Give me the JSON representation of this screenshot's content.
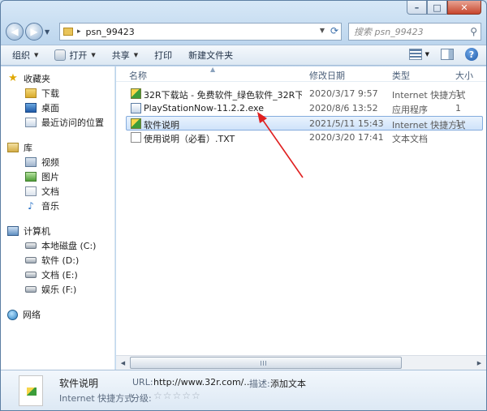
{
  "window": {
    "minimize_glyph": "–",
    "maximize_glyph": "□",
    "close_glyph": "✕"
  },
  "address": {
    "path": "psn_99423",
    "search_placeholder": "搜索 psn_99423"
  },
  "toolbar": {
    "organize": "组织",
    "open": "打开",
    "share": "共享",
    "print": "打印",
    "new_folder": "新建文件夹",
    "help": "?"
  },
  "nav": {
    "favorites": {
      "label": "收藏夹",
      "items": [
        {
          "label": "下载"
        },
        {
          "label": "桌面"
        },
        {
          "label": "最近访问的位置"
        }
      ]
    },
    "libraries": {
      "label": "库",
      "items": [
        {
          "label": "视频"
        },
        {
          "label": "图片"
        },
        {
          "label": "文档"
        },
        {
          "label": "音乐"
        }
      ]
    },
    "computer": {
      "label": "计算机",
      "items": [
        {
          "label": "本地磁盘 (C:)"
        },
        {
          "label": "软件 (D:)"
        },
        {
          "label": "文档 (E:)"
        },
        {
          "label": "娱乐 (F:)"
        }
      ]
    },
    "network": {
      "label": "网络"
    }
  },
  "columns": {
    "name": "名称",
    "date": "修改日期",
    "type": "类型",
    "size": "大小"
  },
  "files": [
    {
      "name": "32R下载站 - 免费软件_绿色软件_32R下...",
      "date": "2020/3/17 9:57",
      "type": "Internet 快捷方式",
      "size": "1"
    },
    {
      "name": "PlayStationNow-11.2.2.exe",
      "date": "2020/8/6 13:52",
      "type": "应用程序",
      "size": "1"
    },
    {
      "name": "软件说明",
      "date": "2021/5/11 15:43",
      "type": "Internet 快捷方式",
      "size": "1"
    },
    {
      "name": "使用说明（必看）.TXT",
      "date": "2020/3/20 17:41",
      "type": "文本文档",
      "size": ""
    }
  ],
  "details": {
    "title": "软件说明",
    "url_label": "URL:",
    "url_value": "http://www.32r.com/...",
    "desc_label": "描述:",
    "desc_value": "添加文本",
    "type": "Internet 快捷方式",
    "rating_label": "分级:",
    "rating_stars": "☆☆☆☆☆",
    "rating_value": 0
  },
  "annotation": {
    "color": "#e02020"
  }
}
